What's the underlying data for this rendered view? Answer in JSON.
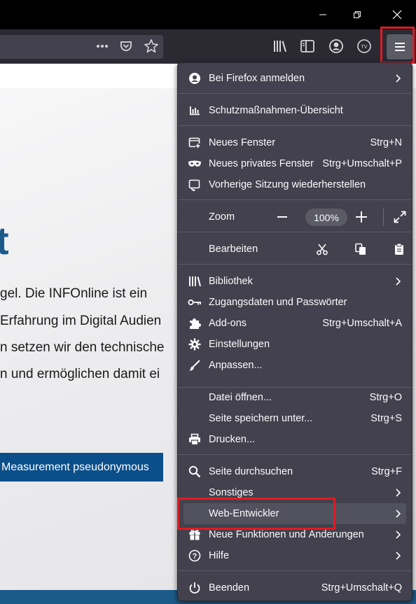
{
  "window": {
    "buttons": [
      "minimize",
      "restore",
      "close"
    ]
  },
  "toolbar": {
    "icons": [
      "more-icon",
      "pocket-icon",
      "bookmark-star-icon",
      "library-icon",
      "sidebar-icon",
      "account-icon",
      "container-tv-icon",
      "menu-icon"
    ]
  },
  "page": {
    "heading_fragment": "t",
    "lines": [
      "gel. Die INFOnline ist ein",
      " Erfahrung im Digital Audien",
      "n setzen wir den technische",
      "n und ermöglichen damit ei"
    ],
    "cta_label": "Measurement pseudonymous"
  },
  "menu": {
    "sign_in": "Bei Firefox anmelden",
    "protections": "Schutzmaßnahmen-Übersicht",
    "new_window": "Neues Fenster",
    "new_window_sc": "Strg+N",
    "private_window": "Neues privates Fenster",
    "private_window_sc": "Strg+Umschalt+P",
    "restore_session": "Vorherige Sitzung wiederherstellen",
    "zoom_label": "Zoom",
    "zoom_minus": "−",
    "zoom_value": "100%",
    "zoom_plus": "+",
    "edit_label": "Bearbeiten",
    "library": "Bibliothek",
    "logins": "Zugangsdaten und Passwörter",
    "addons": "Add-ons",
    "addons_sc": "Strg+Umschalt+A",
    "settings": "Einstellungen",
    "customize": "Anpassen...",
    "open_file": "Datei öffnen...",
    "open_file_sc": "Strg+O",
    "save_page": "Seite speichern unter...",
    "save_page_sc": "Strg+S",
    "print": "Drucken...",
    "find": "Seite durchsuchen",
    "find_sc": "Strg+F",
    "more": "Sonstiges",
    "web_dev": "Web-Entwickler",
    "whats_new": "Neue Funktionen und Änderungen",
    "help": "Hilfe",
    "quit": "Beenden",
    "quit_sc": "Strg+Umschalt+Q"
  },
  "colors": {
    "menu_bg": "#42414d",
    "highlight": "#e01b24",
    "brand_blue": "#0b4f8a"
  }
}
